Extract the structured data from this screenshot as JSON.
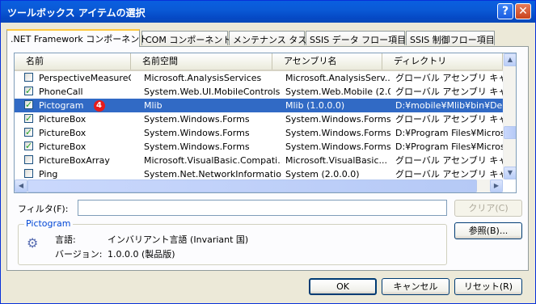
{
  "window": {
    "title": "ツールボックス アイテムの選択",
    "help": "?",
    "close": "✕"
  },
  "tabs": [
    ".NET Framework コンポーネント",
    "COM コンポーネント",
    "メンテナンス タスク",
    "SSIS データ フロー項目",
    "SSIS 制御フロー項目"
  ],
  "columns": [
    "名前",
    "名前空間",
    "アセンブリ名",
    "ディレクトリ"
  ],
  "rows": [
    {
      "checked": false,
      "name": "PerspectiveMeasureG...",
      "ns": "Microsoft.AnalysisServices",
      "asm": "Microsoft.AnalysisServ...",
      "dir": "グローバル アセンブリ キャッシュ"
    },
    {
      "checked": true,
      "name": "PhoneCall",
      "ns": "System.Web.UI.MobileControls",
      "asm": "System.Web.Mobile (2.0...",
      "dir": "グローバル アセンブリ キャッシュ"
    },
    {
      "checked": true,
      "name": "Pictogram",
      "badge": "4",
      "ns": "Mlib",
      "asm": "Mlib (1.0.0.0)",
      "dir": "D:¥mobile¥Mlib¥bin¥Debug"
    },
    {
      "checked": true,
      "name": "PictureBox",
      "ns": "System.Windows.Forms",
      "asm": "System.Windows.Forms...",
      "dir": "グローバル アセンブリ キャッシュ"
    },
    {
      "checked": true,
      "name": "PictureBox",
      "ns": "System.Windows.Forms",
      "asm": "System.Windows.Forms...",
      "dir": "D:¥Program Files¥Microsoft"
    },
    {
      "checked": true,
      "name": "PictureBox",
      "ns": "System.Windows.Forms",
      "asm": "System.Windows.Forms...",
      "dir": "D:¥Program Files¥Microsoft"
    },
    {
      "checked": false,
      "name": "PictureBoxArray",
      "ns": "Microsoft.VisualBasic.Compati...",
      "asm": "Microsoft.VisualBasic...",
      "dir": "グローバル アセンブリ キャッシュ"
    },
    {
      "checked": false,
      "name": "Ping",
      "ns": "System.Net.NetworkInformation",
      "asm": "System (2.0.0.0)",
      "dir": "グローバル アセンブリ キャッシュ"
    }
  ],
  "filter": {
    "label": "フィルタ(F):",
    "value": ""
  },
  "clear_button": "クリア(C)",
  "browse_button": "参照(B)...",
  "info": {
    "title": "Pictogram",
    "language_label": "言語:",
    "language_value": "インバリアント言語 (Invariant 国)",
    "version_label": "バージョン:",
    "version_value": "1.0.0.0 (製品版)"
  },
  "footer": {
    "ok": "OK",
    "cancel": "キャンセル",
    "reset": "リセット(R)"
  }
}
